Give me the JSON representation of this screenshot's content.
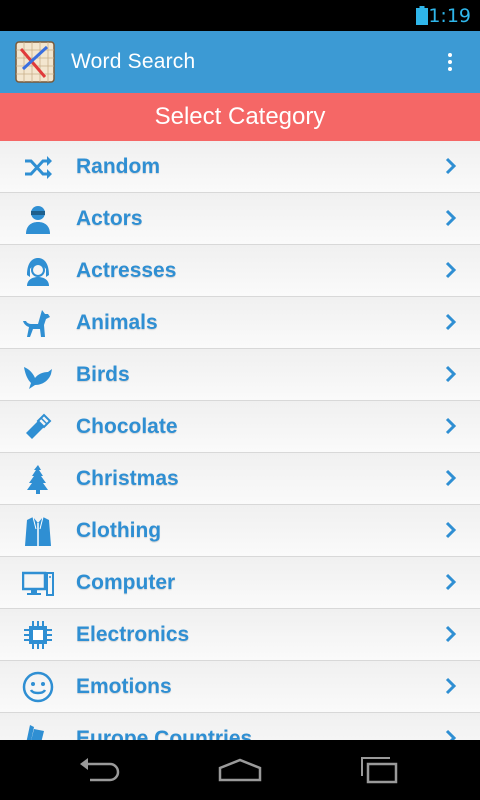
{
  "status_bar": {
    "time": "1:19"
  },
  "app": {
    "title": "Word Search"
  },
  "header": {
    "title": "Select Category"
  },
  "categories": [
    {
      "label": "Random",
      "icon": "shuffle-icon"
    },
    {
      "label": "Actors",
      "icon": "actor-icon"
    },
    {
      "label": "Actresses",
      "icon": "actress-icon"
    },
    {
      "label": "Animals",
      "icon": "dog-icon"
    },
    {
      "label": "Birds",
      "icon": "bird-icon"
    },
    {
      "label": "Chocolate",
      "icon": "chocolate-icon"
    },
    {
      "label": "Christmas",
      "icon": "christmas-tree-icon"
    },
    {
      "label": "Clothing",
      "icon": "jacket-icon"
    },
    {
      "label": "Computer",
      "icon": "computer-icon"
    },
    {
      "label": "Electronics",
      "icon": "chip-icon"
    },
    {
      "label": "Emotions",
      "icon": "smiley-icon"
    },
    {
      "label": "Europe Countries",
      "icon": "flag-icon"
    }
  ],
  "colors": {
    "action_bar": "#3c9ad4",
    "header": "#f56766",
    "label": "#2f8fd3",
    "status_time": "#2fb6ea"
  }
}
